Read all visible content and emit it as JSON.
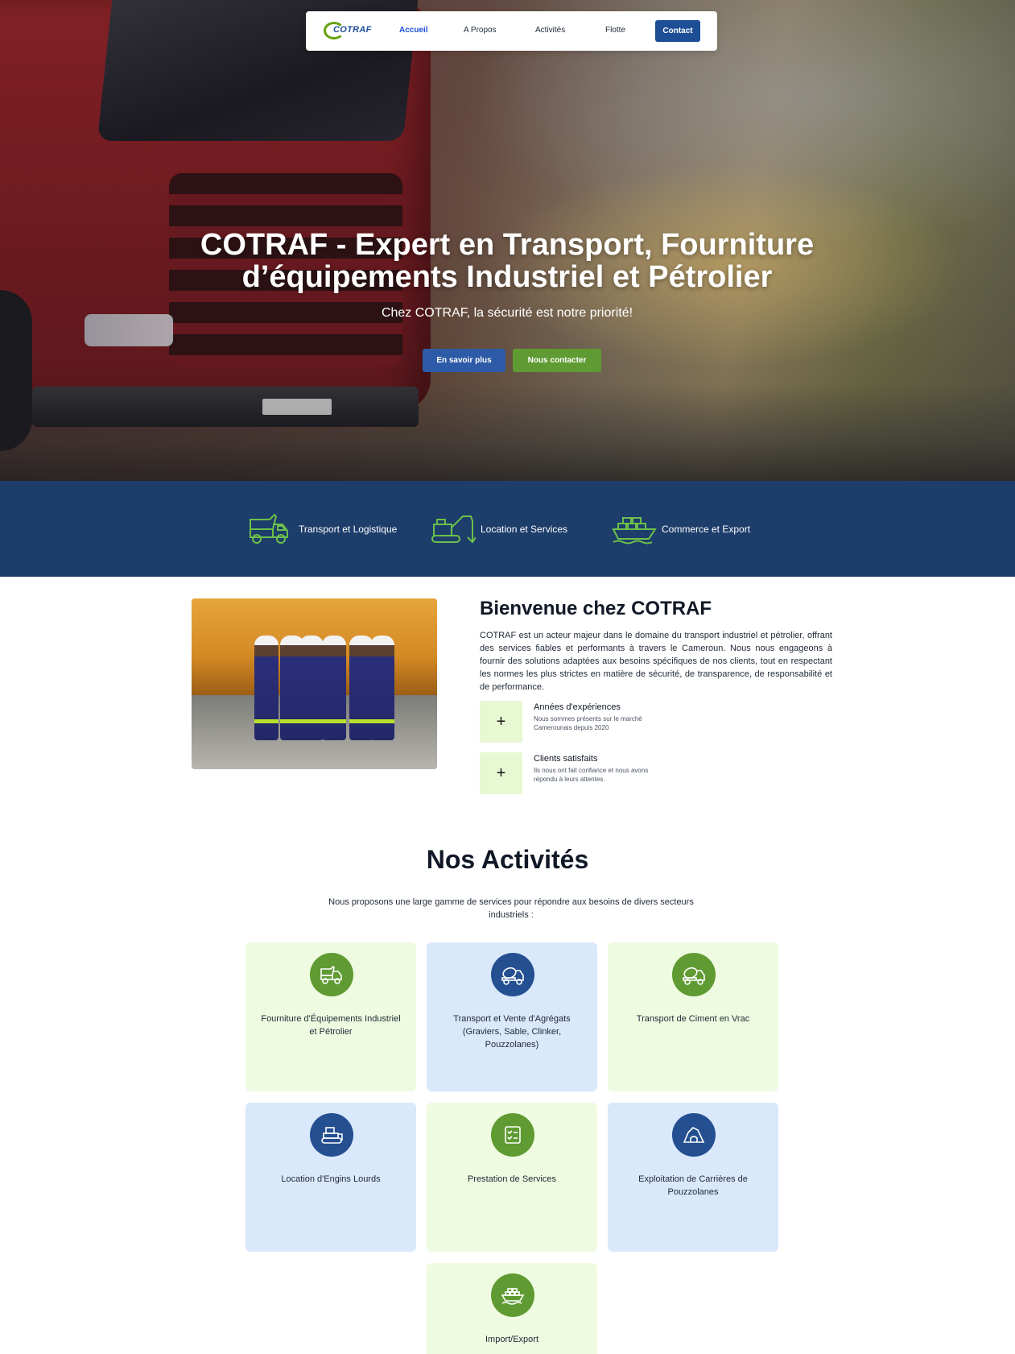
{
  "nav": {
    "logo_text": "COTRAF",
    "items": [
      "Accueil",
      "A Propos",
      "Activités",
      "Flotte"
    ],
    "contact_label": "Contact",
    "active_item": "Accueil"
  },
  "hero": {
    "title_line1": "COTRAF - Expert en Transport, Fourniture",
    "title_line2": "d’équipements Industriel et Pétrolier",
    "subtitle": "Chez COTRAF, la sécurité est notre priorité!",
    "btn_learn": "En savoir plus",
    "btn_contact": "Nous contacter"
  },
  "features": [
    {
      "label": "Transport et Logistique",
      "icon": "dump-truck-icon"
    },
    {
      "label": "Location et Services",
      "icon": "excavator-icon"
    },
    {
      "label": "Commerce et Export",
      "icon": "cargo-ship-icon"
    }
  ],
  "welcome": {
    "title": "Bienvenue chez COTRAF",
    "text": "COTRAF est un acteur majeur dans le domaine du transport industriel et pétrolier, offrant des services fiables et performants à travers le Cameroun. Nous nous engageons à fournir des solutions adaptées aux besoins spécifiques de nos clients, tout en respectant les normes les plus strictes en matière de sécurité, de transparence, de responsabilité et de performance.",
    "stats": [
      {
        "value": "+",
        "title": "Années d'expériences",
        "desc": "Nous sommes présents sur le marché Camerounais depuis 2020"
      },
      {
        "value": "+",
        "title": "Clients satisfaits",
        "desc": "Ils nous ont fait confiance et nous avons répondu à leurs attentes."
      }
    ]
  },
  "activities": {
    "title": "Nos Activités",
    "intro": "Nous proposons une large gamme de services pour répondre aux besoins de divers secteurs industriels :",
    "cards": [
      {
        "label": "Fourniture d'Équipements Industriel et Pétrolier",
        "icon": "dump-truck-icon",
        "color": "#5f9b32"
      },
      {
        "label": "Transport et Vente d'Agrégats (Graviers, Sable, Clinker, Pouzzolanes)",
        "icon": "concrete-mixer-icon",
        "color": "#244f91"
      },
      {
        "label": "Transport de Ciment en Vrac",
        "icon": "concrete-mixer-icon",
        "color": "#5f9b32"
      },
      {
        "label": "Location d'Engins Lourds",
        "icon": "bulldozer-icon",
        "color": "#244f91"
      },
      {
        "label": "Prestation de Services",
        "icon": "checklist-icon",
        "color": "#5f9b32"
      },
      {
        "label": "Exploitation de Carrières de Pouzzolanes",
        "icon": "quarry-icon",
        "color": "#244f91"
      },
      {
        "label": "Import/Export",
        "icon": "cargo-ship-icon",
        "color": "#5f9b32"
      }
    ]
  },
  "colors": {
    "primary_blue": "#1e4e96",
    "primary_green": "#5f9b32",
    "strip_bg": "#1d3d6b",
    "card_green": "#eefbe0",
    "card_blue": "#d9e8fb"
  }
}
